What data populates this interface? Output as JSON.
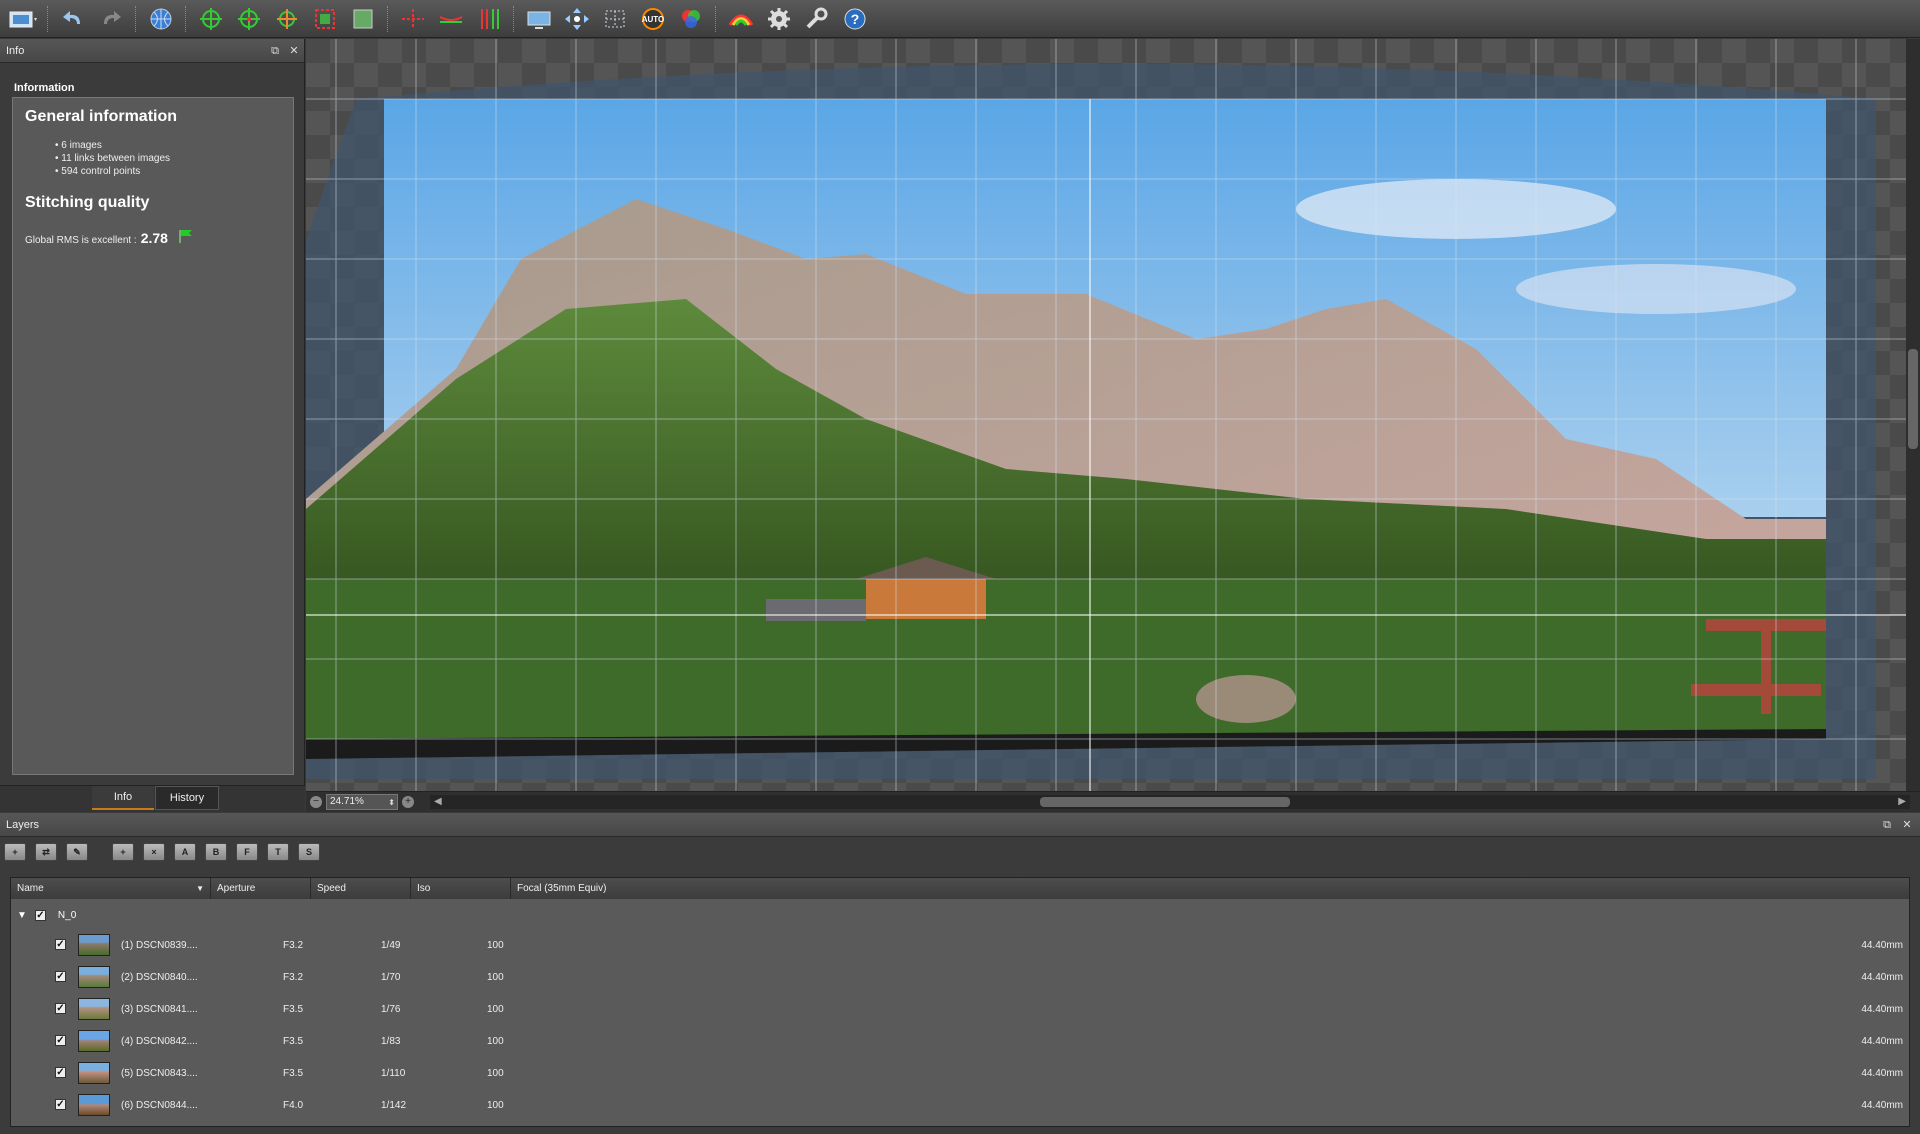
{
  "toolbar": {
    "icons": [
      "project-icon",
      "undo-icon",
      "redo-icon",
      "globe-icon",
      "center-icon",
      "recenter-icon",
      "rotate-icon",
      "crop-icon",
      "fit-icon",
      "horizon-icon",
      "straighten-icon",
      "vertical-lines-icon",
      "display-icon",
      "move-icon",
      "grid-points-icon",
      "auto-icon",
      "color-icon",
      "exposure-icon",
      "settings-icon",
      "tools-icon",
      "help-icon"
    ]
  },
  "info_panel": {
    "title": "Info",
    "section_label": "Information",
    "general_title": "General information",
    "general_items": [
      "6 images",
      "11 links between images",
      "594 control points"
    ],
    "quality_title": "Stitching quality",
    "rms_label": "Global RMS is excellent :",
    "rms_value": "2.78",
    "tabs": [
      "Info",
      "History"
    ]
  },
  "canvas": {
    "zoom": "24.71%"
  },
  "layers_panel": {
    "title": "Layers",
    "toolbar_letters": [
      "A",
      "B",
      "F",
      "T",
      "S"
    ],
    "columns": [
      "Name",
      "Aperture",
      "Speed",
      "Iso",
      "Focal (35mm Equiv)"
    ],
    "group_name": "N_0",
    "rows": [
      {
        "name": "(1) DSCN0839....",
        "aperture": "F3.2",
        "speed": "1/49",
        "iso": "100",
        "focal": "44.40mm"
      },
      {
        "name": "(2) DSCN0840....",
        "aperture": "F3.2",
        "speed": "1/70",
        "iso": "100",
        "focal": "44.40mm"
      },
      {
        "name": "(3) DSCN0841....",
        "aperture": "F3.5",
        "speed": "1/76",
        "iso": "100",
        "focal": "44.40mm"
      },
      {
        "name": "(4) DSCN0842....",
        "aperture": "F3.5",
        "speed": "1/83",
        "iso": "100",
        "focal": "44.40mm"
      },
      {
        "name": "(5) DSCN0843....",
        "aperture": "F3.5",
        "speed": "1/110",
        "iso": "100",
        "focal": "44.40mm"
      },
      {
        "name": "(6) DSCN0844....",
        "aperture": "F4.0",
        "speed": "1/142",
        "iso": "100",
        "focal": "44.40mm"
      }
    ]
  }
}
